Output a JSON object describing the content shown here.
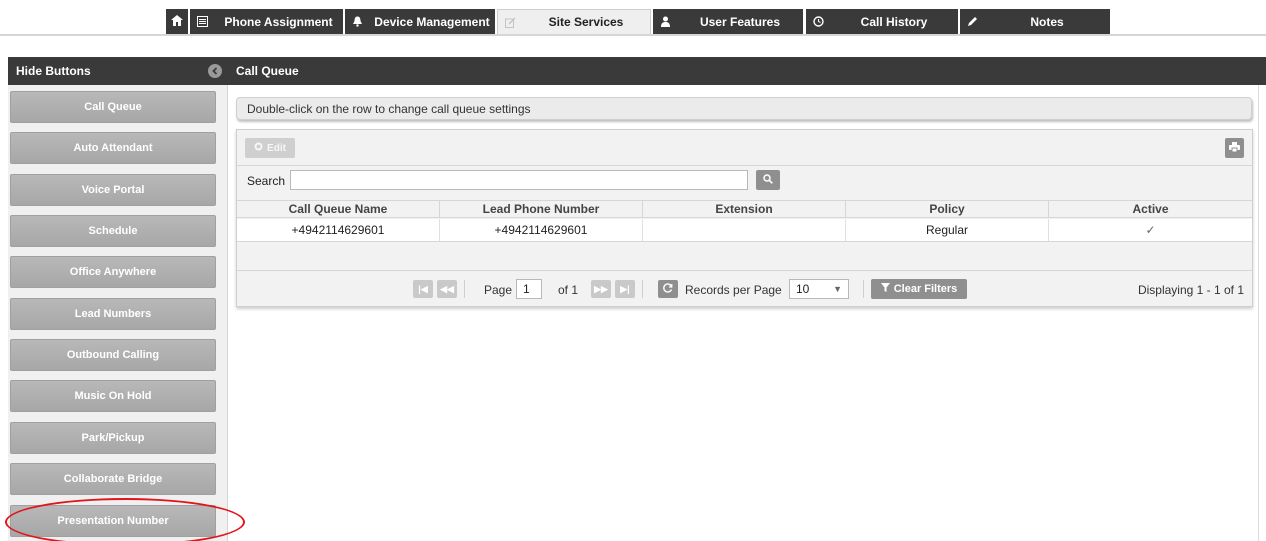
{
  "tabs": [
    {
      "label": "Phone Assignment",
      "icon": "list-icon"
    },
    {
      "label": "Device Management",
      "icon": "bell-icon"
    },
    {
      "label": "Site Services",
      "icon": "edit-icon",
      "active": true
    },
    {
      "label": "User Features",
      "icon": "user-icon"
    },
    {
      "label": "Call History",
      "icon": "clock-icon"
    },
    {
      "label": "Notes",
      "icon": "pencil-icon"
    }
  ],
  "sidebar": {
    "title": "Hide Buttons",
    "items": [
      {
        "label": "Call Queue"
      },
      {
        "label": "Auto Attendant"
      },
      {
        "label": "Voice Portal"
      },
      {
        "label": "Schedule"
      },
      {
        "label": "Office Anywhere"
      },
      {
        "label": "Lead Numbers"
      },
      {
        "label": "Outbound Calling"
      },
      {
        "label": "Music On Hold"
      },
      {
        "label": "Park/Pickup"
      },
      {
        "label": "Collaborate Bridge"
      },
      {
        "label": "Presentation Number"
      }
    ],
    "highlight_color": "#e1141b"
  },
  "main": {
    "title": "Call Queue",
    "hint": "Double-click on the row to change call queue settings",
    "toolbar": {
      "edit_label": "Edit"
    },
    "search": {
      "label": "Search",
      "value": ""
    },
    "table": {
      "columns": [
        "Call Queue Name",
        "Lead Phone Number",
        "Extension",
        "Policy",
        "Active"
      ],
      "rows": [
        {
          "name": "+4942114629601",
          "lead": "+4942114629601",
          "extension": "",
          "policy": "Regular",
          "active": "✓"
        }
      ]
    },
    "pager": {
      "page_label": "Page",
      "page_value": "1",
      "of_label": "of 1",
      "records_label": "Records per Page",
      "records_value": "10",
      "clear_label": "Clear Filters",
      "displaying": "Displaying 1 - 1 of 1"
    }
  },
  "colors": {
    "dark": "#3a3a3a",
    "button_grey": "#b0b0b0",
    "accent_red": "#e1141b"
  }
}
